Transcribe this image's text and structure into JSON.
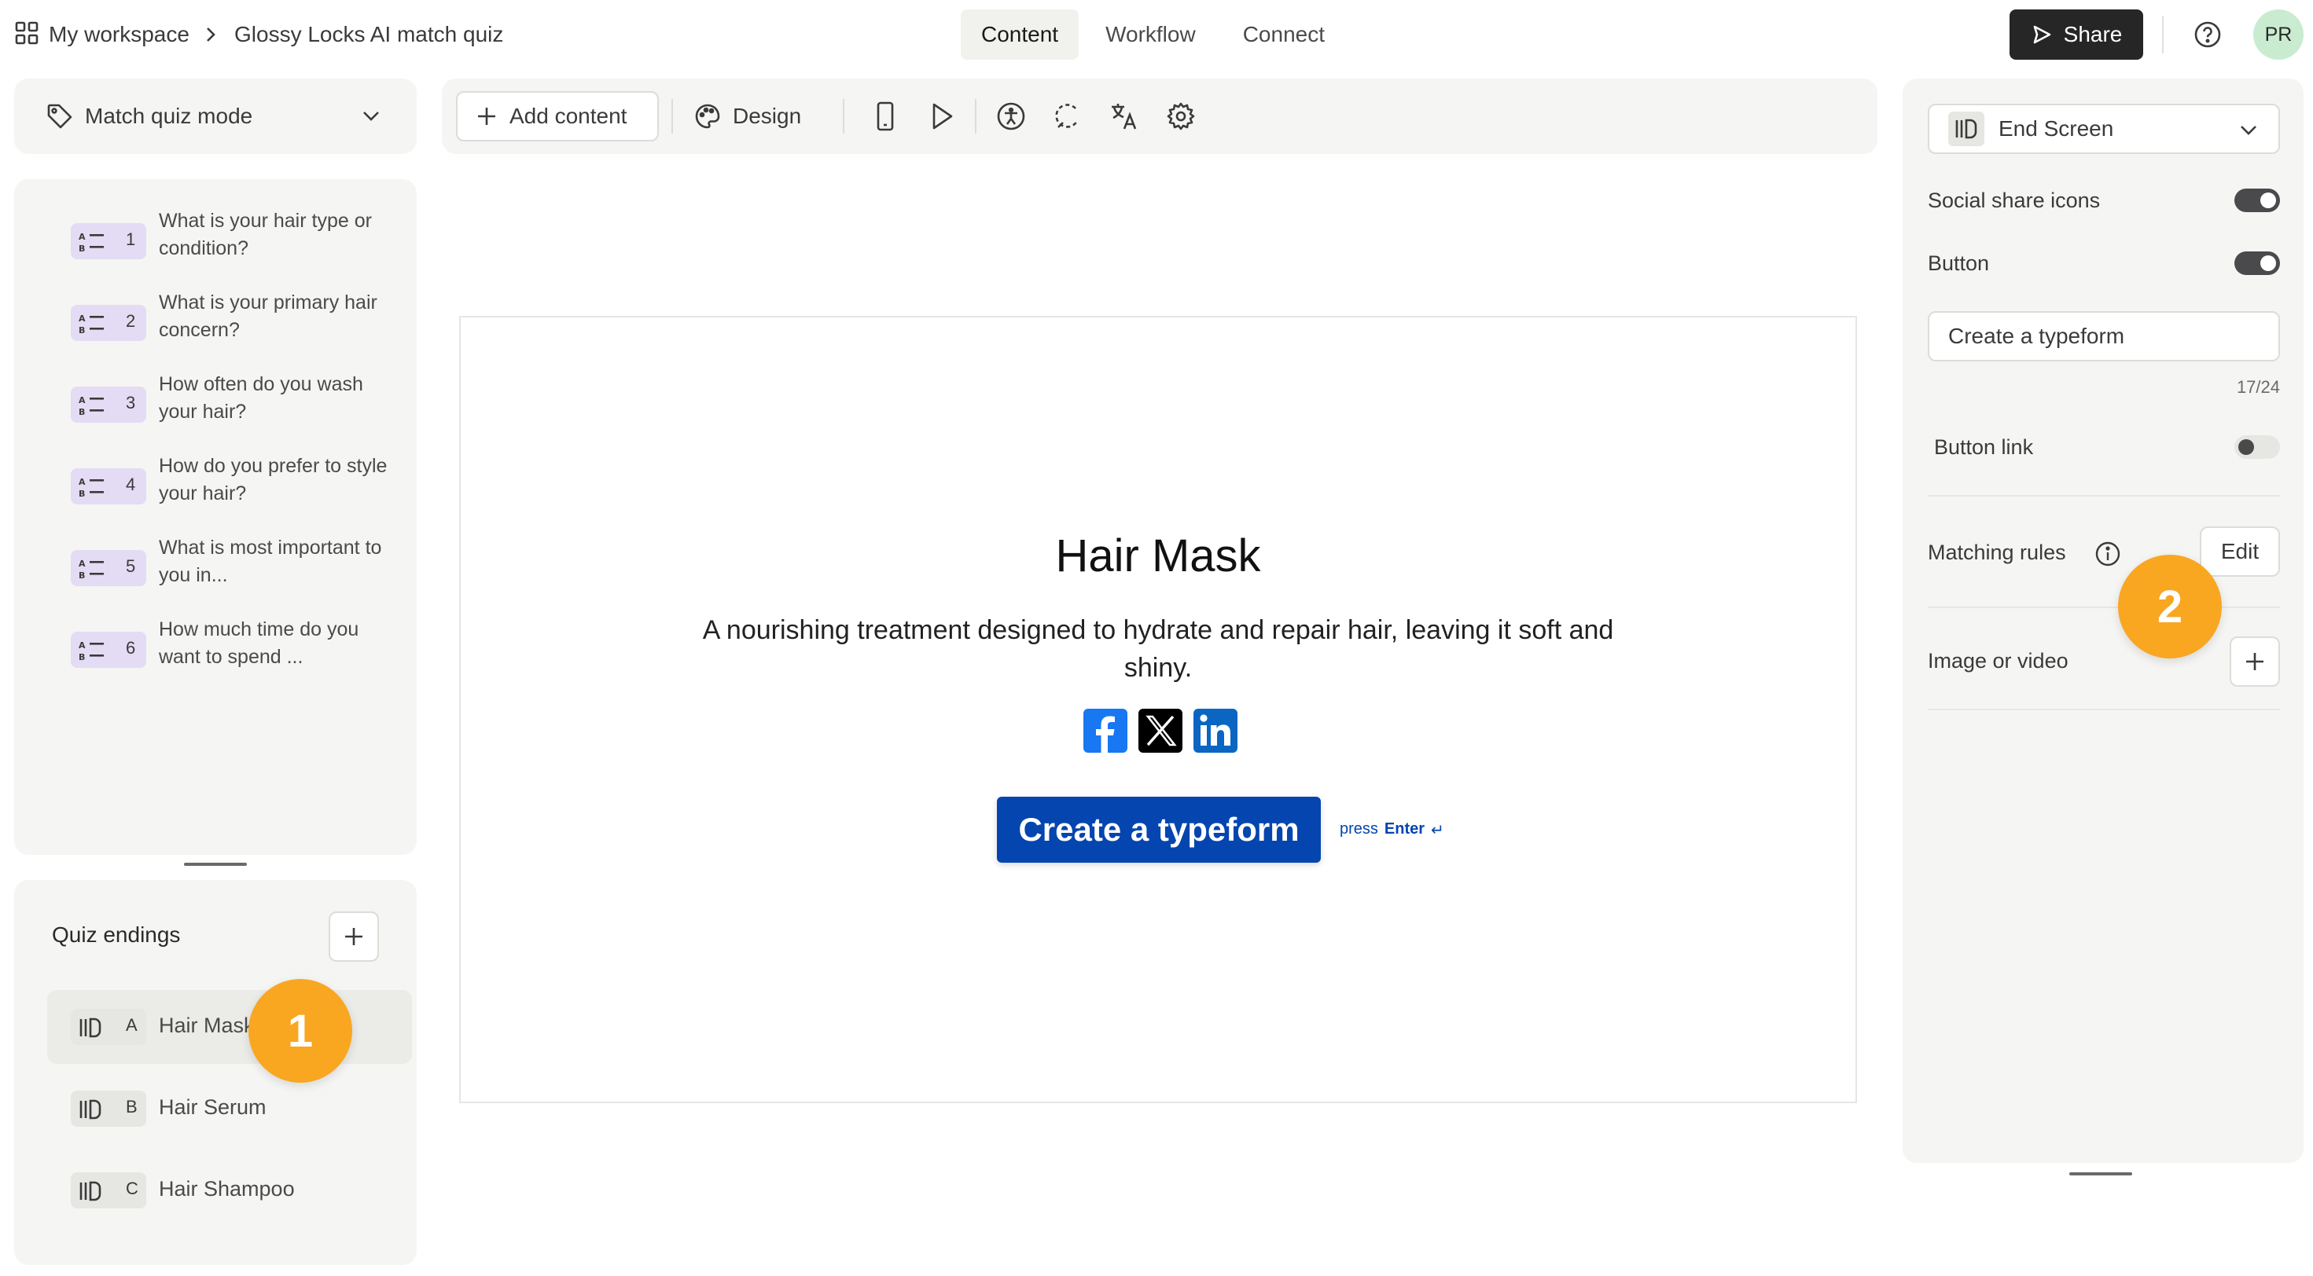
{
  "header": {
    "workspace": "My workspace",
    "form_title": "Glossy Locks AI match quiz",
    "tabs": [
      {
        "label": "Content"
      },
      {
        "label": "Workflow"
      },
      {
        "label": "Connect"
      }
    ],
    "share_label": "Share",
    "avatar_initials": "PR"
  },
  "left": {
    "mode_label": "Match quiz mode",
    "questions": [
      {
        "num": "1",
        "text": "What is your hair type or condition?"
      },
      {
        "num": "2",
        "text": "What is your primary hair concern?"
      },
      {
        "num": "3",
        "text": "How often do you wash your hair?"
      },
      {
        "num": "4",
        "text": "How do you prefer to style your hair?"
      },
      {
        "num": "5",
        "text": "What is most important to you in..."
      },
      {
        "num": "6",
        "text": "How much time do you want to spend ..."
      }
    ],
    "endings_title": "Quiz endings",
    "endings": [
      {
        "letter": "A",
        "label": "Hair Mask"
      },
      {
        "letter": "B",
        "label": "Hair Serum"
      },
      {
        "letter": "C",
        "label": "Hair Shampoo"
      }
    ]
  },
  "toolbar": {
    "add_content": "Add content",
    "design": "Design"
  },
  "preview": {
    "title": "Hair Mask",
    "description": "A nourishing treatment designed to hydrate and repair hair, leaving it soft and shiny.",
    "button_label": "Create a typeform",
    "hint_prefix": "press",
    "hint_key": "Enter",
    "hint_symbol": "↵"
  },
  "right": {
    "screen_type": "End Screen",
    "social_share_label": "Social share icons",
    "social_share_on": true,
    "button_label": "Button",
    "button_on": true,
    "button_text_value": "Create a typeform",
    "char_count": "17/24",
    "button_link_label": "Button link",
    "button_link_on": false,
    "matching_rules_label": "Matching rules",
    "edit_label": "Edit",
    "image_video_label": "Image or video"
  },
  "markers": {
    "m1": "1",
    "m2": "2"
  },
  "colors": {
    "accent_button": "#0445AF",
    "marker": "#F9A621",
    "question_badge": "#E3DCF4",
    "facebook": "#1877F2",
    "linkedin": "#0A66C2"
  }
}
